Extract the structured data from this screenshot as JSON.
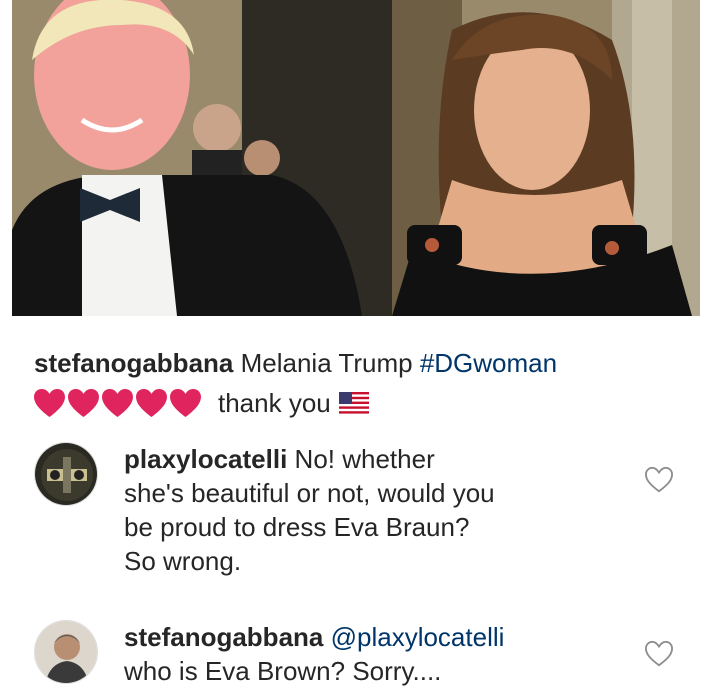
{
  "post": {
    "caption_user": "stefanogabbana",
    "caption_text": "Melania Trump",
    "caption_hashtag": "#DGwoman",
    "hearts": 5,
    "thanks_text": "thank you",
    "flag": "us-flag-icon"
  },
  "comments": [
    {
      "user": "plaxylocatelli",
      "lines": [
        "No!  whether",
        "she's beautiful or not, would you",
        "be proud to dress Eva Braun?",
        "So wrong."
      ]
    },
    {
      "user": "stefanogabbana",
      "mention": "@plaxylocatelli",
      "lines": [
        "who is Eva Brown? Sorry...."
      ]
    }
  ],
  "colors": {
    "text": "#262626",
    "link": "#003569",
    "heart": "#e0245e"
  }
}
